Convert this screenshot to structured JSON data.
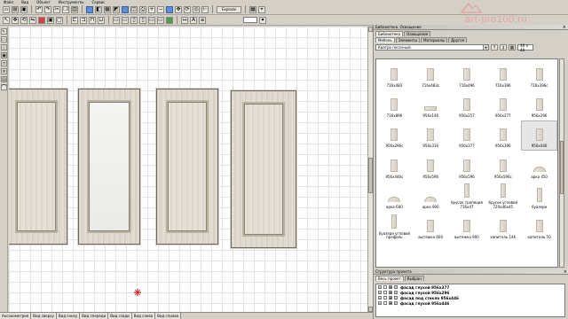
{
  "menu": [
    "Файл",
    "Вид",
    "Объект",
    "Инструменты",
    "Сервис"
  ],
  "toolbar": {
    "explode_label": "Explode",
    "zoom_value": ""
  },
  "watermark": {
    "text": "art-pro100.ru"
  },
  "library_panel": {
    "title": "Библиотека. Освещение",
    "tabs": [
      "Библиотека",
      "Освещение"
    ],
    "subtabs": [
      "Мебель",
      "Элементы",
      "Материалы",
      "Другое"
    ],
    "category": "Кватро песочный",
    "thumb_size": "48 × 48",
    "items": [
      {
        "label": "716x483",
        "shape": "door"
      },
      {
        "label": "716x483с",
        "shape": "door"
      },
      {
        "label": "716x496",
        "shape": "door"
      },
      {
        "label": "716x396",
        "shape": "door"
      },
      {
        "label": "716x396с",
        "shape": "door"
      },
      {
        "label": "716x896",
        "shape": "door"
      },
      {
        "label": "956x146",
        "shape": "wide"
      },
      {
        "label": "956x257",
        "shape": "door"
      },
      {
        "label": "956x277",
        "shape": "door"
      },
      {
        "label": "956x296",
        "shape": "door"
      },
      {
        "label": "956x296с",
        "shape": "door"
      },
      {
        "label": "956x316",
        "shape": "door"
      },
      {
        "label": "956x377",
        "shape": "door"
      },
      {
        "label": "956x396",
        "shape": "door"
      },
      {
        "label": "956x446",
        "shape": "door",
        "selected": true
      },
      {
        "label": "956x446с",
        "shape": "door"
      },
      {
        "label": "956x596",
        "shape": "door"
      },
      {
        "label": "956x596",
        "shape": "door"
      },
      {
        "label": "956x596с",
        "shape": "door"
      },
      {
        "label": "арка 450",
        "shape": "arch"
      },
      {
        "label": "арка 600",
        "shape": "arch"
      },
      {
        "label": "арка 900",
        "shape": "arch"
      },
      {
        "label": "брусок трапеция 716x47",
        "shape": "tall"
      },
      {
        "label": "брусок угловой 720x46x45",
        "shape": "tall"
      },
      {
        "label": "буазери",
        "shape": "tall"
      },
      {
        "label": "буазери угловой профиль",
        "shape": "tall"
      },
      {
        "label": "вытяжка 600",
        "shape": "door"
      },
      {
        "label": "вытяжка 900",
        "shape": "door"
      },
      {
        "label": "капитель 146",
        "shape": "door"
      },
      {
        "label": "капитель 50",
        "shape": "door"
      }
    ]
  },
  "structure_panel": {
    "title": "Структура проекта",
    "tabs": [
      "Весь проект",
      "Выбран"
    ],
    "rows": [
      "фасад глухой 956x377",
      "фасад глухой 956x296",
      "фасад под стекло 956x446",
      "фасад глухой 956x446"
    ]
  },
  "status_tabs": [
    "Аксонометрия",
    "Вид сверху",
    "Вид снизу",
    "Вид спереди",
    "Вид сзади",
    "Вид слева",
    "Вид справа"
  ]
}
